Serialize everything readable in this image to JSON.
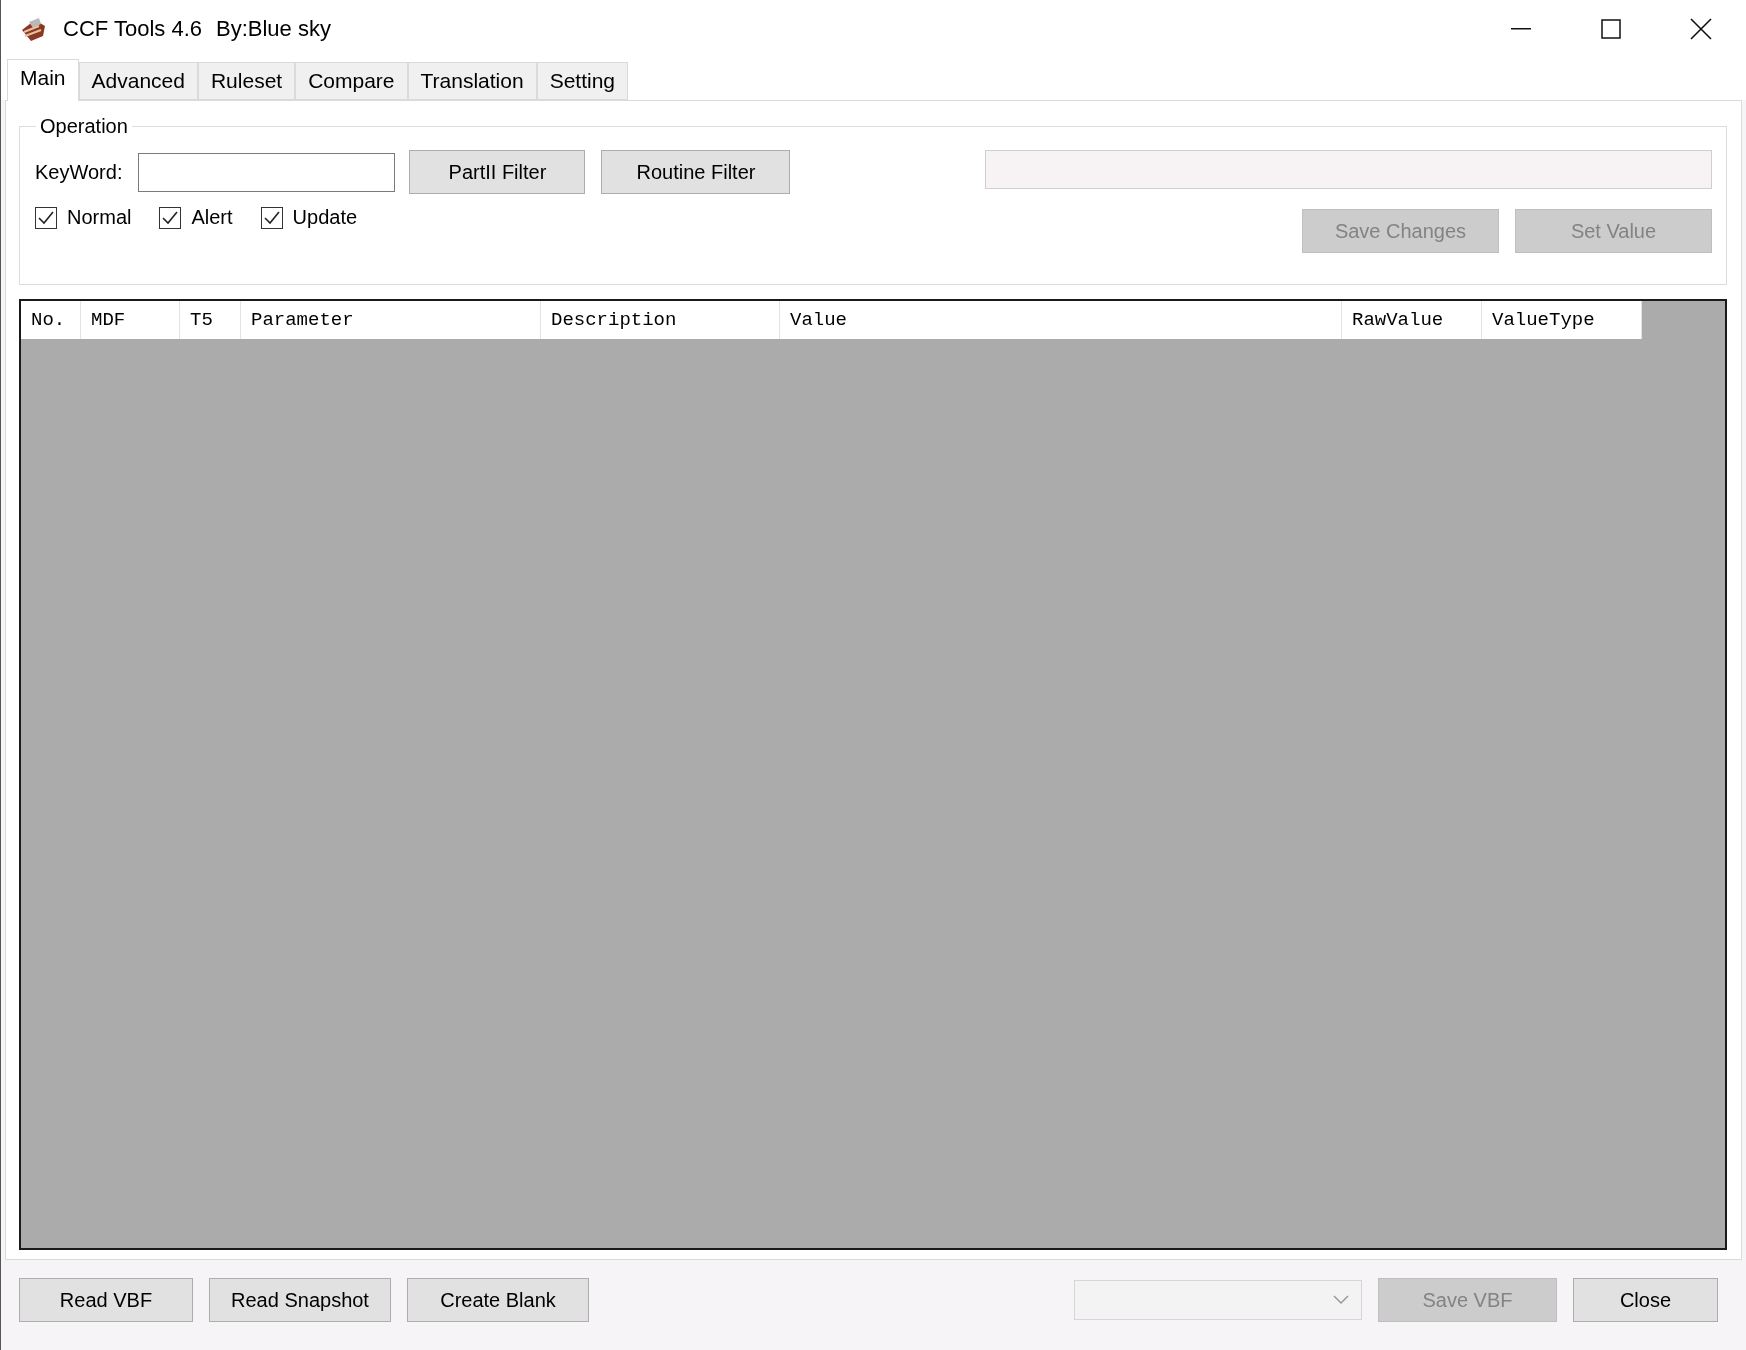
{
  "window": {
    "title": "CCF Tools 4.6",
    "subtitle": "By:Blue sky"
  },
  "tabs": [
    {
      "label": "Main",
      "selected": true
    },
    {
      "label": "Advanced",
      "selected": false
    },
    {
      "label": "Ruleset",
      "selected": false
    },
    {
      "label": "Compare",
      "selected": false
    },
    {
      "label": "Translation",
      "selected": false
    },
    {
      "label": "Setting",
      "selected": false
    }
  ],
  "operation": {
    "title": "Operation",
    "keyword_label": "KeyWord:",
    "filter_buttons": [
      {
        "label": "PartII Filter",
        "disabled": false
      },
      {
        "label": "Routine Filter",
        "disabled": false
      }
    ],
    "checkboxes": [
      {
        "label": "Normal",
        "checked": true
      },
      {
        "label": "Alert",
        "checked": true
      },
      {
        "label": "Update",
        "checked": true
      }
    ],
    "action_buttons": [
      {
        "label": "Save Changes",
        "disabled": true
      },
      {
        "label": "Set Value",
        "disabled": true
      }
    ]
  },
  "table": {
    "columns": [
      "No.",
      "MDF",
      "T5",
      "Parameter",
      "Description",
      "Value",
      "RawValue",
      "ValueType"
    ]
  },
  "bottom_bar": {
    "left_buttons": [
      {
        "label": "Read VBF",
        "disabled": false
      },
      {
        "label": "Read Snapshot",
        "disabled": false
      },
      {
        "label": "Create Blank",
        "disabled": false
      }
    ],
    "right_buttons": [
      {
        "label": "Save VBF",
        "disabled": true
      },
      {
        "label": "Close",
        "disabled": false
      }
    ]
  }
}
